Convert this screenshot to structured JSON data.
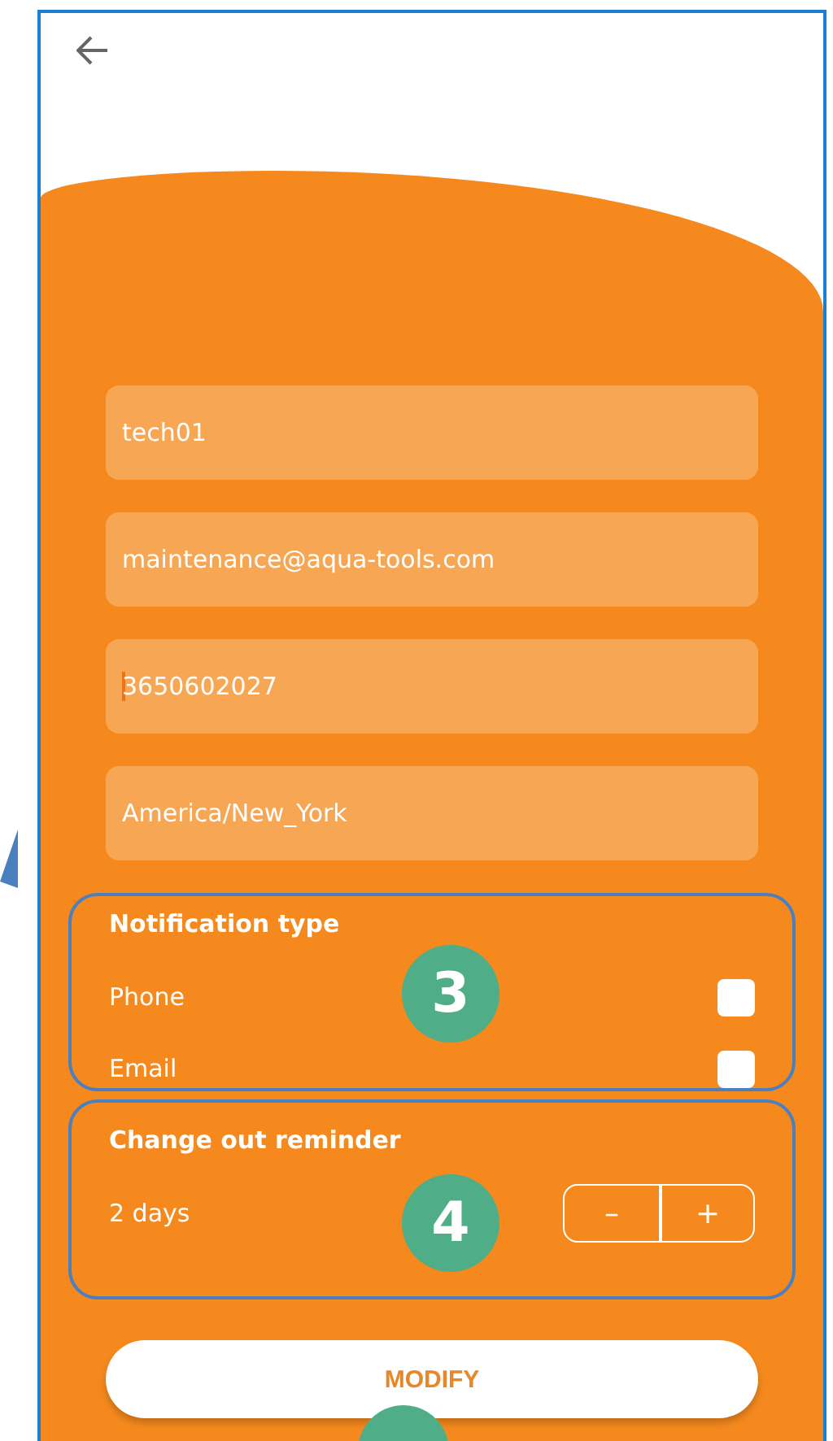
{
  "fields": [
    {
      "value": "tech01",
      "focused": false
    },
    {
      "value": "maintenance@aqua-tools.com",
      "focused": false
    },
    {
      "value": "3650602027",
      "focused": true
    },
    {
      "value": "America/New_York",
      "focused": false
    }
  ],
  "notification": {
    "title": "Notification type",
    "marker": "3",
    "options": [
      {
        "label": "Phone",
        "checked": false
      },
      {
        "label": "Email",
        "checked": false
      }
    ]
  },
  "reminder": {
    "title": "Change out reminder",
    "marker": "4",
    "value": "2 days",
    "decrement": "–",
    "increment": "+"
  },
  "submit": {
    "label": "MODIFY"
  }
}
